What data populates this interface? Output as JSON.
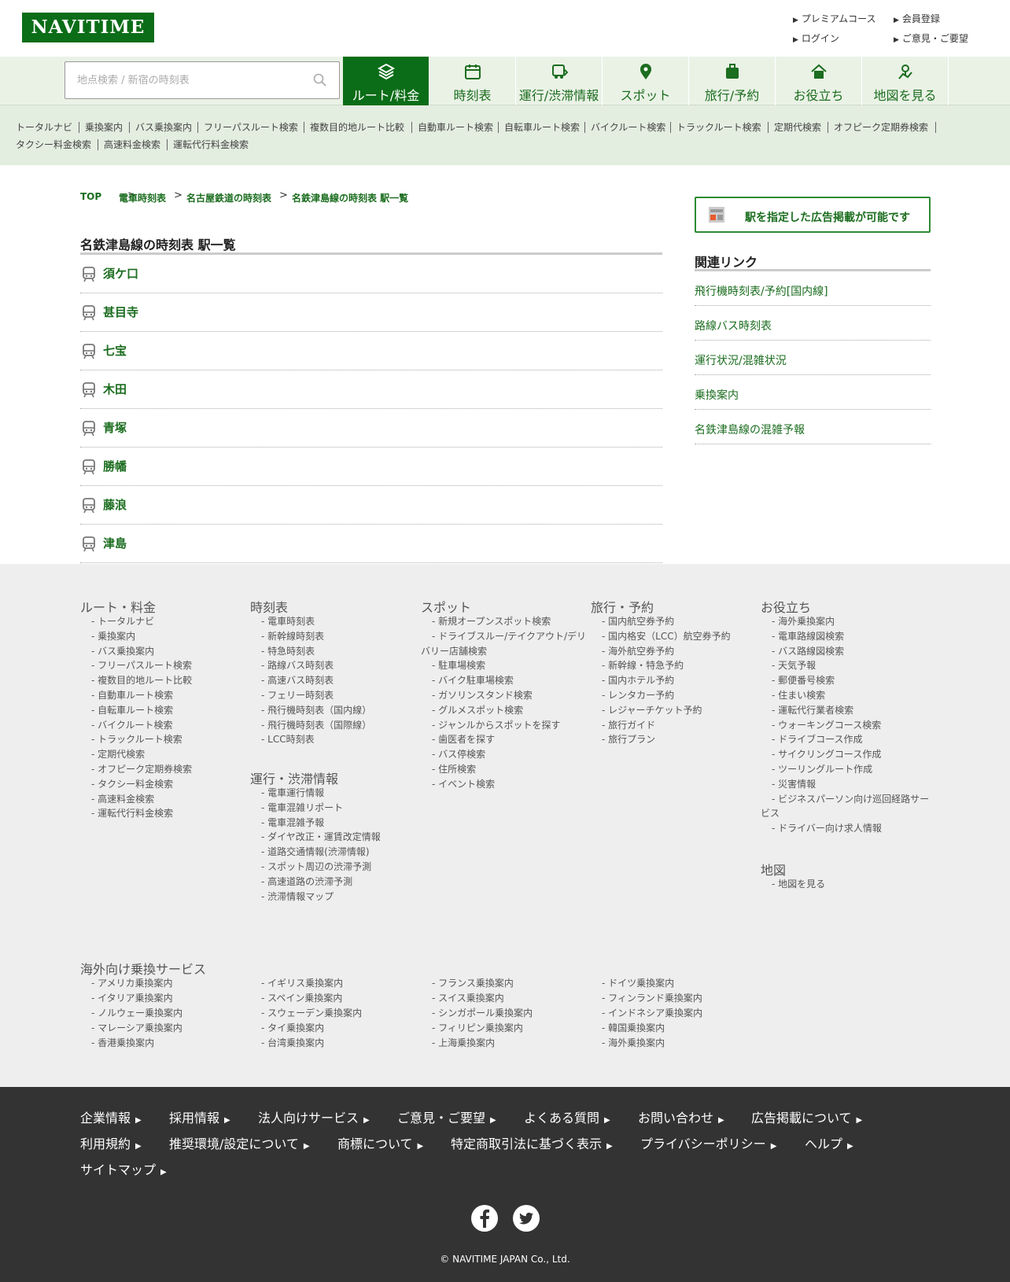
{
  "header": {
    "logo": "NAVITIME",
    "top_links": [
      "プレミアムコース",
      "会員登録",
      "ログイン",
      "ご意見・ご要望"
    ]
  },
  "search": {
    "placeholder": "地点検索 / 新宿の時刻表"
  },
  "nav": [
    {
      "label": "ルート/料金",
      "icon": "route-icon"
    },
    {
      "label": "時刻表",
      "icon": "calendar-icon"
    },
    {
      "label": "運行/渋滞情報",
      "icon": "traffic-icon"
    },
    {
      "label": "スポット",
      "icon": "pin-icon"
    },
    {
      "label": "旅行/予約",
      "icon": "luggage-icon"
    },
    {
      "label": "お役立ち",
      "icon": "house-icon"
    },
    {
      "label": "地図を見る",
      "icon": "map-icon"
    }
  ],
  "subnav": [
    "トータルナビ",
    "乗換案内",
    "バス乗換案内",
    "フリーパスルート検索",
    "複数目的地ルート比較",
    "自動車ルート検索",
    "自転車ルート検索",
    "バイクルート検索",
    "トラックルート検索",
    "定期代検索",
    "オフピーク定期券検索",
    "タクシー料金検索",
    "高速料金検索",
    "運転代行料金検索"
  ],
  "breadcrumb": [
    "TOP",
    "電車時刻表",
    "名古屋鉄道の時刻表",
    "名鉄津島線の時刻表 駅一覧"
  ],
  "main": {
    "title": "名鉄津島線の時刻表 駅一覧",
    "stations": [
      "須ケ口",
      "甚目寺",
      "七宝",
      "木田",
      "青塚",
      "勝幡",
      "藤浪",
      "津島"
    ]
  },
  "side": {
    "ad": "駅を指定した広告掲載が可能です",
    "related_title": "関連リンク",
    "related": [
      "飛行機時刻表/予約[国内線]",
      "路線バス時刻表",
      "運行状況/混雑状況",
      "乗換案内",
      "名鉄津島線の混雑予報"
    ]
  },
  "footer": {
    "cols": [
      {
        "title": "ルート・料金",
        "items": [
          "トータルナビ",
          "乗換案内",
          "バス乗換案内",
          "フリーパスルート検索",
          "複数目的地ルート比較",
          "自動車ルート検索",
          "自転車ルート検索",
          "バイクルート検索",
          "トラックルート検索",
          "定期代検索",
          "オフピーク定期券検索",
          "タクシー料金検索",
          "高速料金検索",
          "運転代行料金検索"
        ]
      },
      {
        "title": "時刻表",
        "items": [
          "電車時刻表",
          "新幹線時刻表",
          "特急時刻表",
          "路線バス時刻表",
          "高速バス時刻表",
          "フェリー時刻表",
          "飛行機時刻表（国内線）",
          "飛行機時刻表（国際線）",
          "LCC時刻表"
        ]
      },
      {
        "title": "運行・渋滞情報",
        "items": [
          "電車運行情報",
          "電車混雑リポート",
          "電車混雑予報",
          "ダイヤ改正・運賃改定情報",
          "道路交通情報(渋滞情報)",
          "スポット周辺の渋滞予測",
          "高速道路の渋滞予測",
          "渋滞情報マップ"
        ]
      },
      {
        "title": "スポット",
        "items": [
          "新規オープンスポット検索",
          "ドライブスルー/テイクアウト/デリ",
          "バリー店舗検索",
          "駐車場検索",
          "バイク駐車場検索",
          "ガソリンスタンド検索",
          "グルメスポット検索",
          "ジャンルからスポットを探す",
          "歯医者を探す",
          "バス停検索",
          "住所検索",
          "イベント検索"
        ]
      },
      {
        "title": "旅行・予約",
        "items": [
          "国内航空券予約",
          "国内格安（LCC）航空券予約",
          "海外航空券予約",
          "新幹線・特急予約",
          "国内ホテル予約",
          "レンタカー予約",
          "レジャーチケット予約",
          "旅行ガイド",
          "旅行プラン"
        ]
      },
      {
        "title": "お役立ち",
        "items": [
          "海外乗換案内",
          "電車路線図検索",
          "バス路線図検索",
          "天気予報",
          "郵便番号検索",
          "住まい検索",
          "運転代行業者検索",
          "ウォーキングコース検索",
          "ドライブコース作成",
          "サイクリングコース作成",
          "ツーリングルート作成",
          "災害情報",
          "ビジネスパーソン向け巡回経路サー",
          "ビス",
          "ドライバー向け求人情報"
        ]
      },
      {
        "title": "地図",
        "items": [
          "地図を見る"
        ]
      }
    ],
    "overseas_title": "海外向け乗換サービス",
    "overseas": [
      "アメリカ乗換案内",
      "イタリア乗換案内",
      "ノルウェー乗換案内",
      "マレーシア乗換案内",
      "香港乗換案内",
      "イギリス乗換案内",
      "スペイン乗換案内",
      "スウェーデン乗換案内",
      "タイ乗換案内",
      "台湾乗換案内",
      "フランス乗換案内",
      "スイス乗換案内",
      "シンガポール乗換案内",
      "フィリピン乗換案内",
      "上海乗換案内",
      "ドイツ乗換案内",
      "フィンランド乗換案内",
      "インドネシア乗換案内",
      "韓国乗換案内",
      "海外乗換案内"
    ],
    "bottom_links": [
      "企業情報",
      "採用情報",
      "法人向けサービス",
      "ご意見・ご要望",
      "よくある質問",
      "お問い合わせ",
      "広告掲載について",
      "利用規約",
      "推奨環境/設定について",
      "商標について",
      "特定商取引法に基づく表示",
      "プライバシーポリシー",
      "ヘルプ",
      "サイトマップ"
    ],
    "copyright": "© NAVITIME JAPAN Co., Ltd."
  },
  "colors": {
    "brand": "#0b6d17",
    "link": "#1b6d1f",
    "nav_bg": "#eaf2e6",
    "footer_bg": "#eeeeee",
    "bottom_bg": "#333333"
  }
}
